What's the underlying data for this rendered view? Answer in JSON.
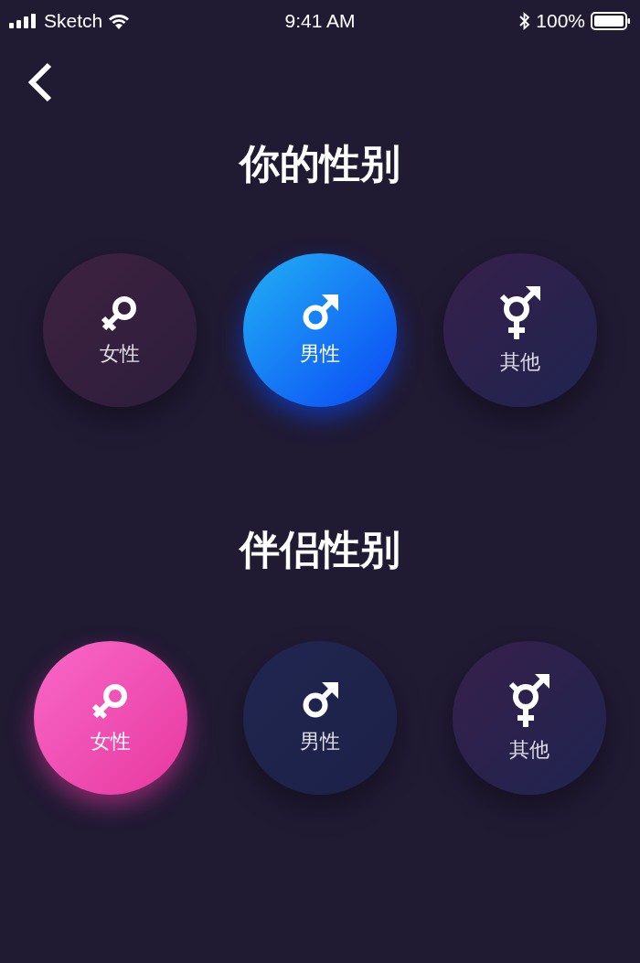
{
  "status_bar": {
    "carrier": "Sketch",
    "time": "9:41 AM",
    "battery": "100%"
  },
  "sections": [
    {
      "title": "你的性别",
      "options": [
        {
          "kind": "female",
          "label": "女性",
          "selected": false
        },
        {
          "kind": "male",
          "label": "男性",
          "selected": true
        },
        {
          "kind": "other",
          "label": "其他",
          "selected": false
        }
      ]
    },
    {
      "title": "伴侣性别",
      "options": [
        {
          "kind": "female",
          "label": "女性",
          "selected": true
        },
        {
          "kind": "male",
          "label": "男性",
          "selected": false
        },
        {
          "kind": "other",
          "label": "其他",
          "selected": false
        }
      ]
    }
  ]
}
